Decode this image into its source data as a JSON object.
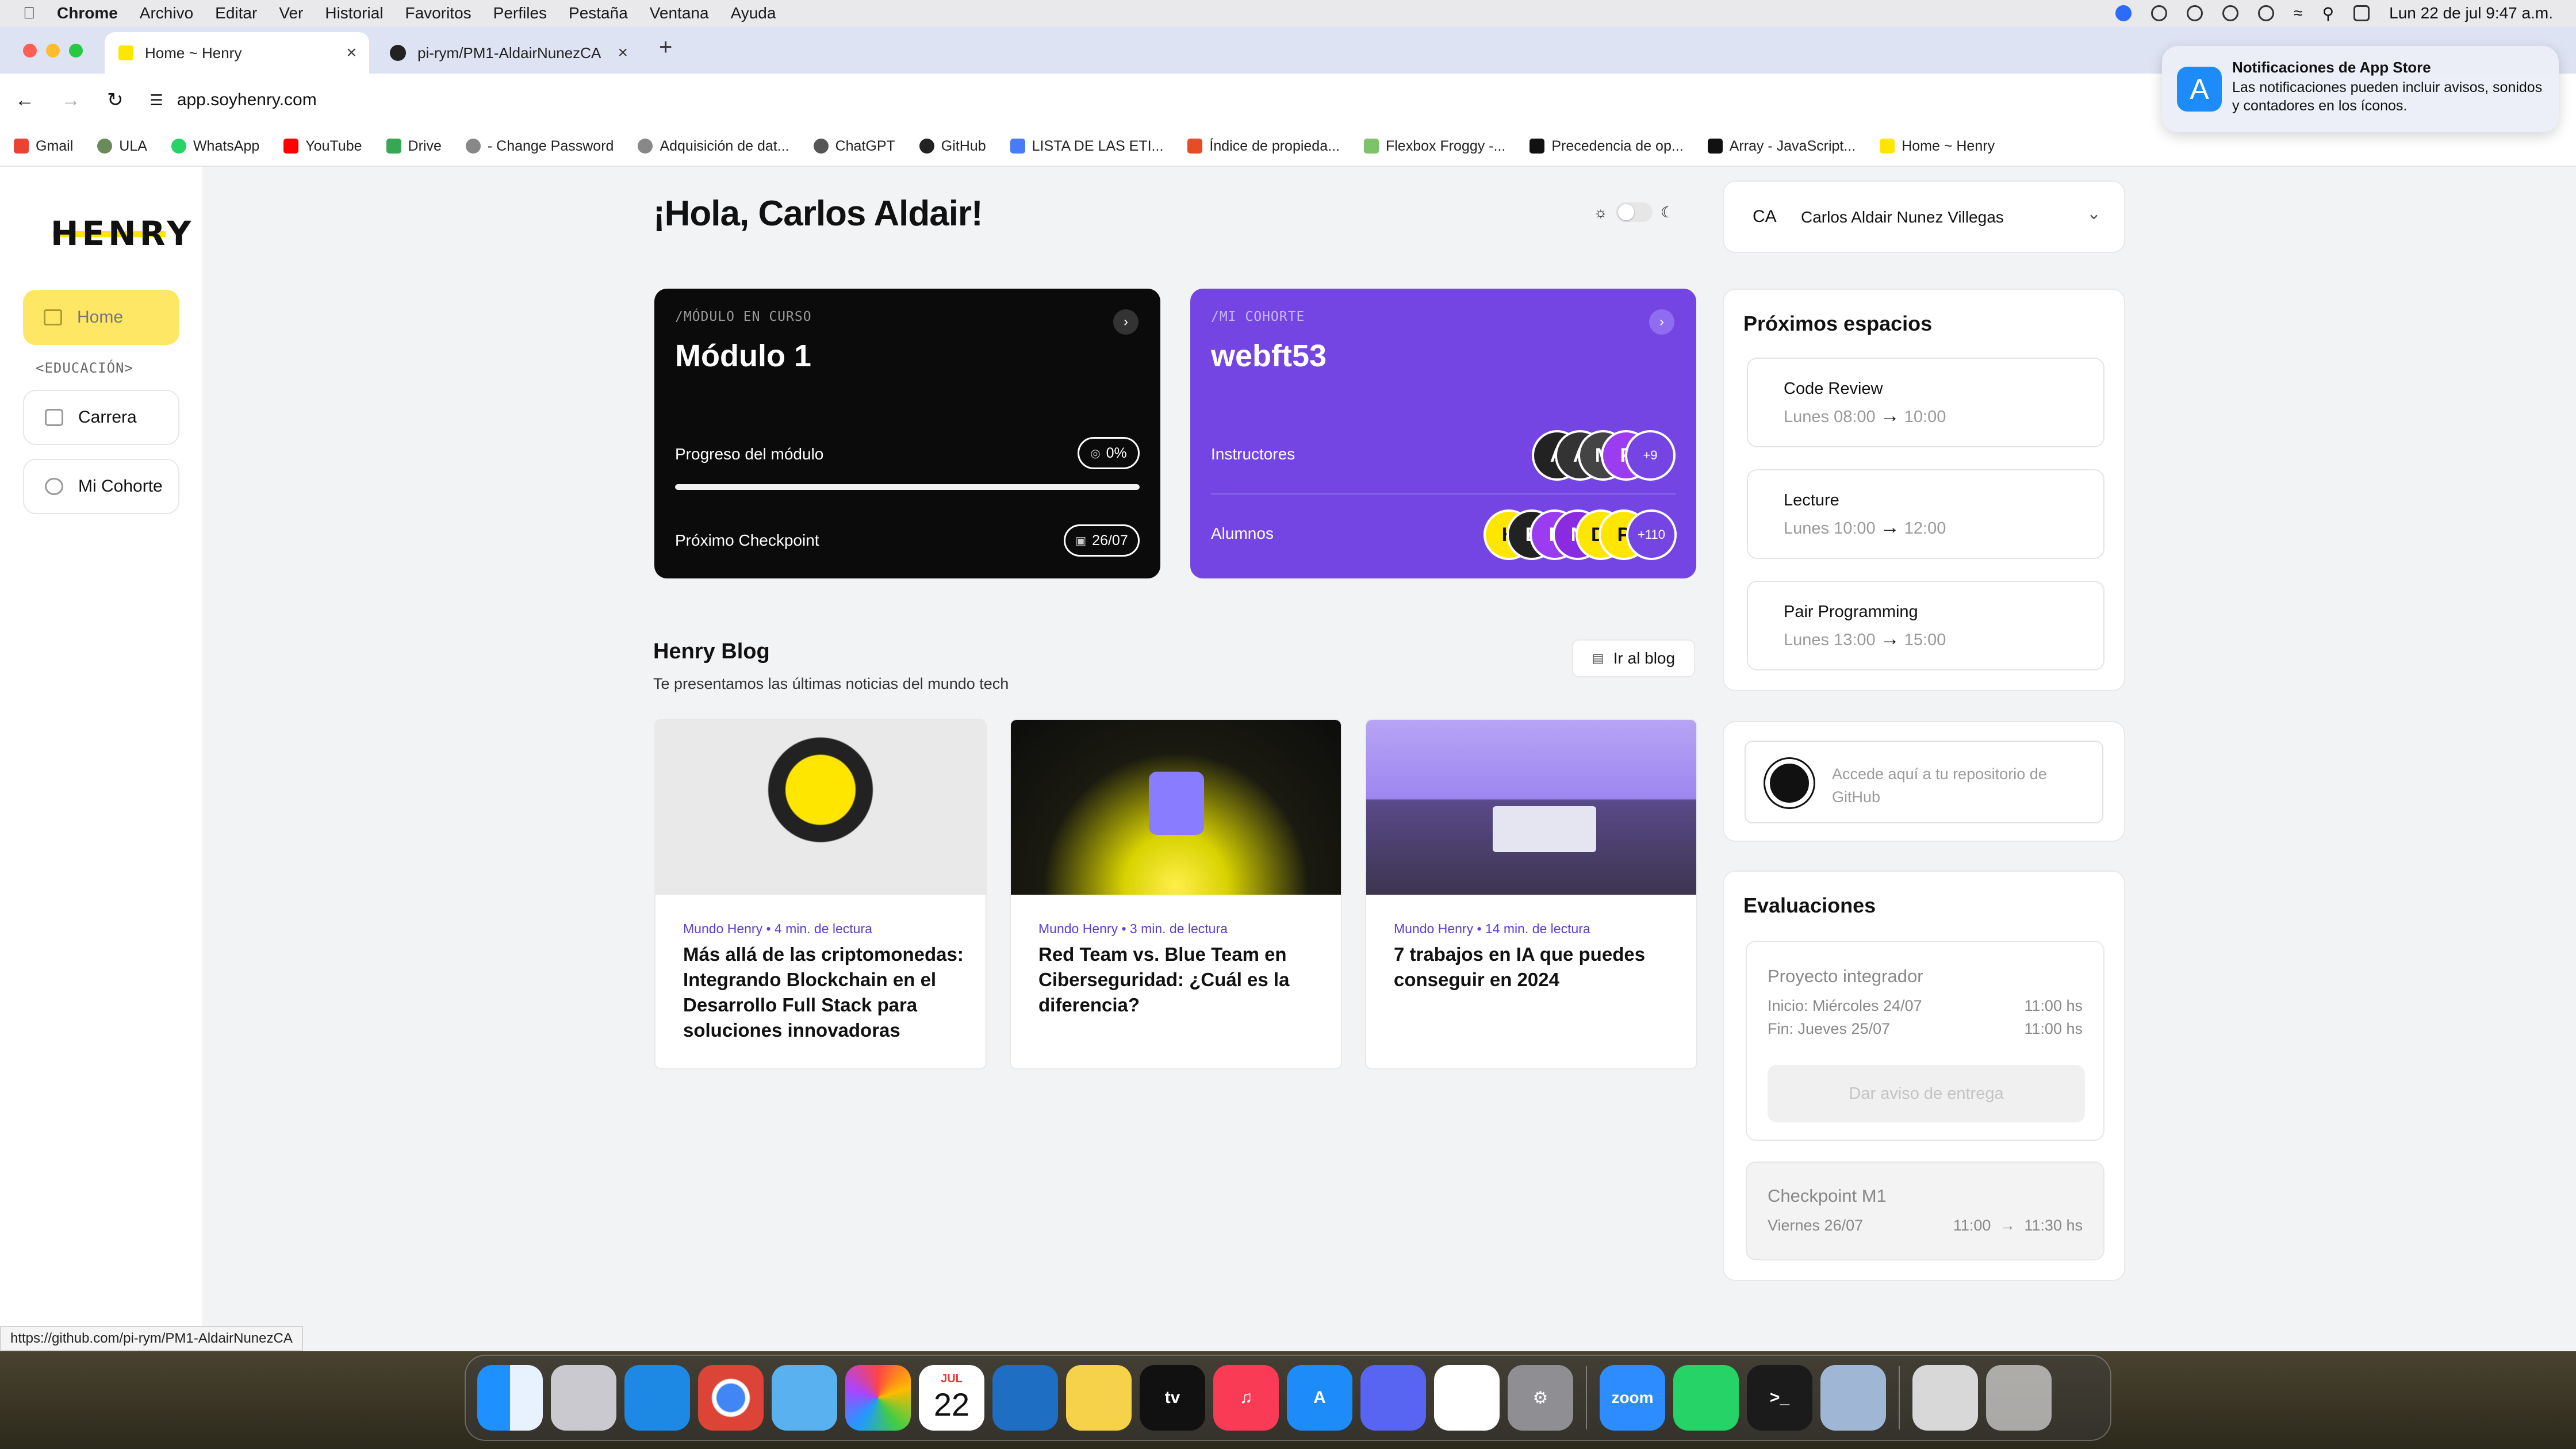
{
  "menubar": {
    "items": [
      "Chrome",
      "Archivo",
      "Editar",
      "Ver",
      "Historial",
      "Favoritos",
      "Perfiles",
      "Pestaña",
      "Ventana",
      "Ayuda"
    ],
    "datetime": "Lun 22 de jul  9:47 a.m."
  },
  "browser": {
    "tabs": [
      {
        "label": "Home ~ Henry"
      },
      {
        "label": "pi-rym/PM1-AldairNunezCA"
      }
    ],
    "url": "app.soyhenry.com",
    "bookmarks": [
      "Gmail",
      "ULA",
      "WhatsApp",
      "YouTube",
      "Drive",
      "- Change Password",
      "Adquisición de dat...",
      "ChatGPT",
      "GitHub",
      "LISTA DE LAS ETI...",
      "Índice de propieda...",
      "Flexbox Froggy -...",
      "Precedencia de op...",
      "Array - JavaScript...",
      "Home ~ Henry"
    ],
    "status_url": "https://github.com/pi-rym/PM1-AldairNunezCA"
  },
  "notification": {
    "title": "Notificaciones de App Store",
    "body": "Las notificaciones pueden incluir avisos, sonidos y contadores en los íconos."
  },
  "sidebar": {
    "logo": "HENRY",
    "home": "Home",
    "section": "<EDUCACIÓN>",
    "items": [
      "Carrera",
      "Mi Cohorte"
    ]
  },
  "header": {
    "greeting": "¡Hola, Carlos Aldair!",
    "user_initials": "CA",
    "user_name": "Carlos Aldair Nunez Villegas"
  },
  "module_card": {
    "tag": "/MÓDULO EN CURSO",
    "title": "Módulo 1",
    "progress_label": "Progreso del módulo",
    "progress_value": "0%",
    "progress_fraction": 0,
    "checkpoint_label": "Próximo Checkpoint",
    "checkpoint_date": "26/07"
  },
  "cohort_card": {
    "tag": "/MI COHORTE",
    "title": "webft53",
    "instructors_label": "Instructores",
    "instructors": [
      "A",
      "A",
      "M",
      "F"
    ],
    "instructors_more": "+9",
    "students_label": "Alumnos",
    "students": [
      "H",
      "E",
      "F",
      "N",
      "DI",
      "P"
    ],
    "students_more": "+110"
  },
  "blog": {
    "title": "Henry Blog",
    "subtitle": "Te presentamos las últimas noticias del mundo tech",
    "button": "Ir al blog",
    "posts": [
      {
        "meta": "Mundo Henry • 4 min. de lectura",
        "title": "Más allá de las criptomonedas: Integrando Blockchain en el Desarrollo Full Stack para soluciones innovadoras"
      },
      {
        "meta": "Mundo Henry • 3 min. de lectura",
        "title": "Red Team vs. Blue Team en Ciberseguridad: ¿Cuál es la diferencia?"
      },
      {
        "meta": "Mundo Henry • 14 min. de lectura",
        "title": "7 trabajos en IA que puedes conseguir en 2024"
      }
    ]
  },
  "spaces": {
    "title": "Próximos espacios",
    "items": [
      {
        "name": "Code Review",
        "start": "Lunes 08:00",
        "end": "10:00"
      },
      {
        "name": "Lecture",
        "start": "Lunes 10:00",
        "end": "12:00"
      },
      {
        "name": "Pair Programming",
        "start": "Lunes 13:00",
        "end": "15:00"
      }
    ]
  },
  "github": {
    "text": "Accede aquí a tu repositorio de GitHub"
  },
  "evaluations": {
    "title": "Evaluaciones",
    "project": {
      "name": "Proyecto integrador",
      "start": "Inicio: Miércoles 24/07",
      "start_time": "11:00 hs",
      "end": "Fin: Jueves 25/07",
      "end_time": "11:00 hs",
      "button": "Dar aviso de entrega"
    },
    "checkpoint": {
      "name": "Checkpoint M1",
      "date": "Viernes 26/07",
      "start": "11:00",
      "end": "11:30 hs"
    }
  },
  "dock": {
    "calendar_month": "JUL",
    "calendar_day": "22",
    "zoom": "zoom",
    "tv": "tv"
  },
  "colors": {
    "accent_yellow": "#ffe600",
    "purple": "#7445e3",
    "dark_card": "#0b0b0b"
  }
}
